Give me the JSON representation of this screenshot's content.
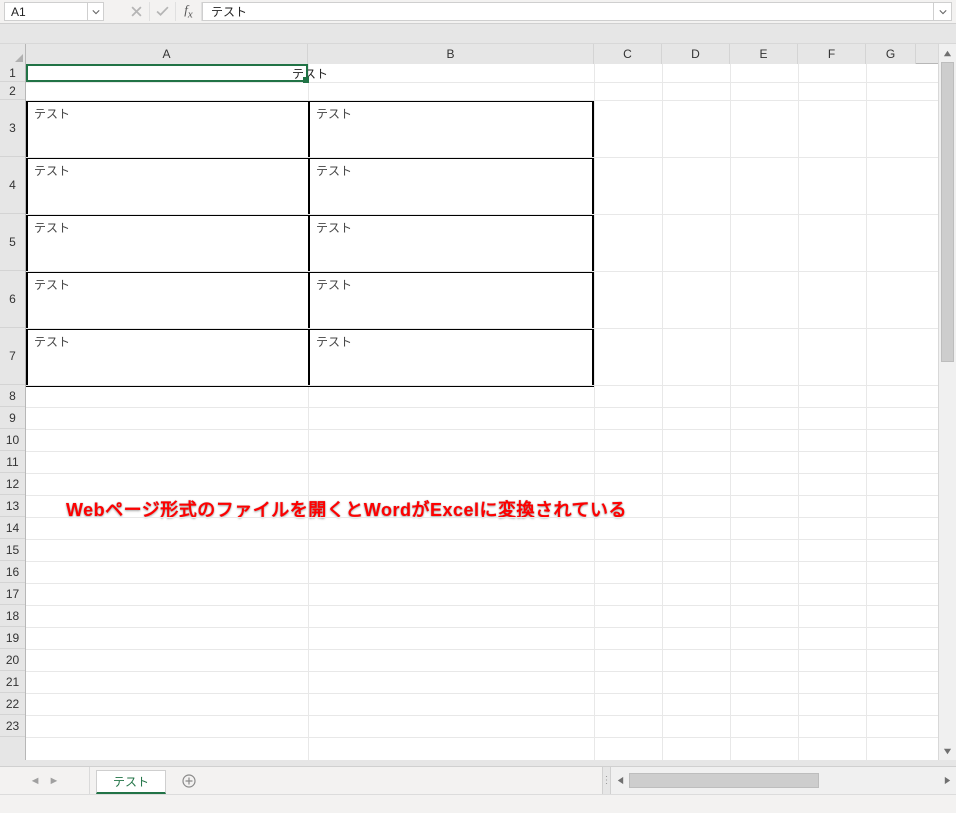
{
  "formula_bar": {
    "name_box": "A1",
    "formula": "テスト"
  },
  "columns": [
    "A",
    "B",
    "C",
    "D",
    "E",
    "F",
    "G"
  ],
  "rows": {
    "short": [
      1,
      2
    ],
    "tall": [
      3,
      4,
      5,
      6,
      7
    ],
    "rest": [
      8,
      9,
      10,
      11,
      12,
      13,
      14,
      15,
      16,
      17,
      18,
      19,
      20,
      21,
      22,
      23
    ]
  },
  "row_heights": {
    "short": 18,
    "tall": 57,
    "rest": 22
  },
  "merged_title": "テスト",
  "table": [
    {
      "a": "テスト",
      "b": "テスト"
    },
    {
      "a": "テスト",
      "b": "テスト"
    },
    {
      "a": "テスト",
      "b": "テスト"
    },
    {
      "a": "テスト",
      "b": "テスト"
    },
    {
      "a": "テスト",
      "b": "テスト"
    }
  ],
  "annotation": "Webページ形式のファイルを開くとWordがExcelに変換されている",
  "sheet_tab": "テスト",
  "col_widths": {
    "A": 282,
    "B": 286,
    "narrow": 68,
    "G": 50
  }
}
